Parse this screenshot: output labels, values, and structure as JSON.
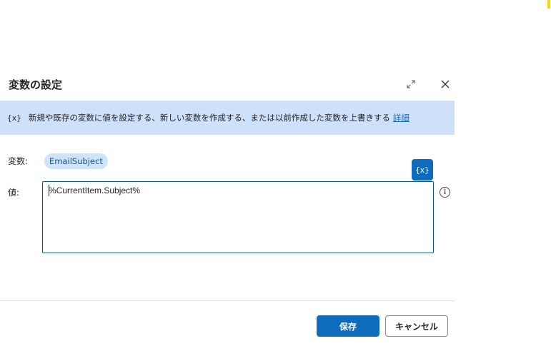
{
  "dialog": {
    "title": "変数の設定",
    "expand_icon": "expand-icon",
    "close_icon": "close-icon"
  },
  "banner": {
    "icon_text": "{x}",
    "text": "新規や既存の変数に値を設定する、新しい変数を作成する、または以前作成した変数を上書きする",
    "link": "詳細"
  },
  "form": {
    "variable_label": "変数:",
    "variable_name": "EmailSubject",
    "value_label": "値:",
    "value": "%CurrentItem.Subject%",
    "variable_picker": "{x}",
    "info_icon": "i"
  },
  "footer": {
    "save": "保存",
    "cancel": "キャンセル"
  },
  "colors": {
    "accent": "#0f6cbd",
    "banner_bg": "#cfe0fb",
    "chip_bg": "#cfe4fa"
  }
}
